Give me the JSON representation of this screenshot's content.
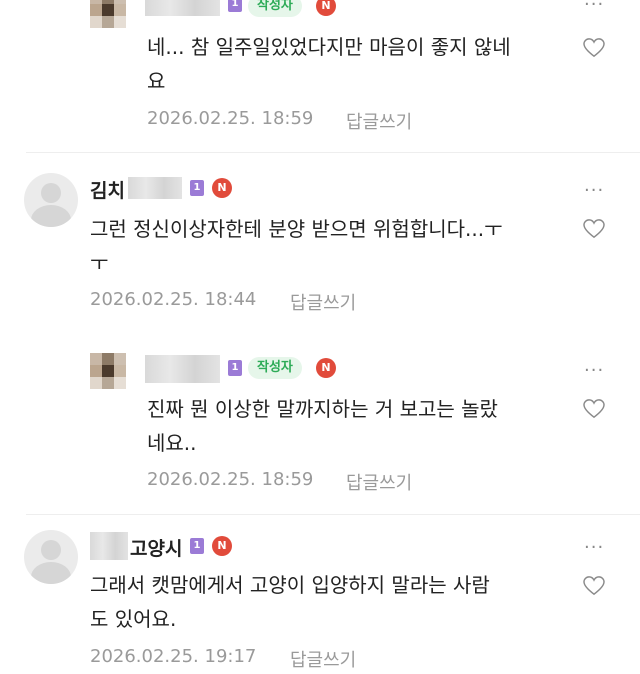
{
  "comments": [
    {
      "author": "",
      "author_badge": "작성자",
      "new_badge": "N",
      "level": "1",
      "text": "네... 참 일주일있었다지만 마음이 좋지 않네요",
      "date": "2026.02.25. 18:59",
      "reply": "답글쓰기"
    },
    {
      "author": "김치",
      "new_badge": "N",
      "level": "1",
      "text": "그런 정신이상자한테 분양 받으면 위험합니다...ㅜㅜ",
      "date": "2026.02.25. 18:44",
      "reply": "답글쓰기",
      "more": "···"
    },
    {
      "author": "",
      "author_badge": "작성자",
      "new_badge": "N",
      "level": "1",
      "text": "진짜 뭔 이상한 말까지하는 거 보고는 놀랐네요..",
      "date": "2026.02.25. 18:59",
      "reply": "답글쓰기",
      "more": "···"
    },
    {
      "author": "고양시",
      "new_badge": "N",
      "level": "1",
      "text": "그래서 캣맘에게서 고양이 입양하지 말라는 사람도 있어요.",
      "date": "2026.02.25. 19:17",
      "reply": "답글쓰기",
      "more": "···"
    }
  ],
  "lines": {
    "c0_l1": "네... 참 일주일있었다지만 마음이 좋지 않네",
    "c0_l2": "요",
    "c1_l1": "그런 정신이상자한테 분양 받으면 위험합니다...ㅜ",
    "c1_l2": "ㅜ",
    "c2_l1": "진짜 뭔 이상한 말까지하는 거 보고는 놀랐",
    "c2_l2": "네요..",
    "c3_l1": "그래서 캣맘에게서 고양이 입양하지 말라는 사람",
    "c3_l2": "도 있어요."
  },
  "icons": {
    "more": "more-dots-icon",
    "like": "heart-icon",
    "avatar": "avatar-icon"
  },
  "colors": {
    "author_badge_bg": "#e6f6ea",
    "author_badge_fg": "#2dab57",
    "new_badge": "#e14b3b",
    "level_badge": "#9b7bd6",
    "meta": "#9a9a9a"
  }
}
